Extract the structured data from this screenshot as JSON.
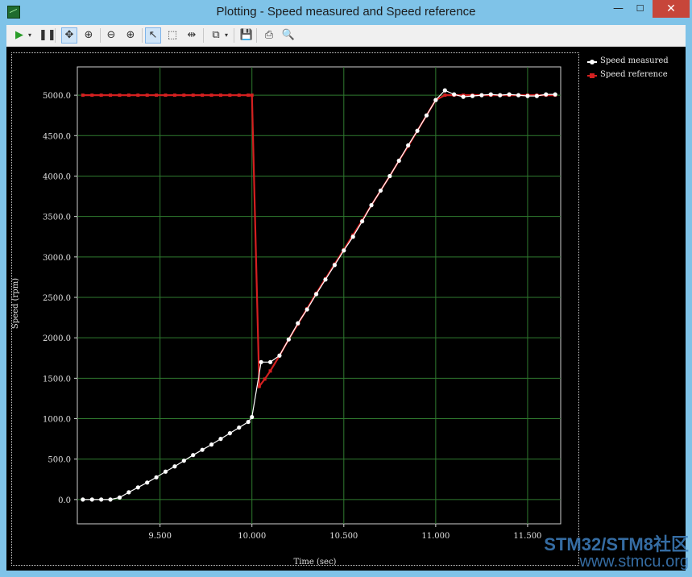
{
  "window": {
    "title": "Plotting  - Speed measured and Speed reference",
    "min_glyph": "—",
    "max_glyph": "☐",
    "close_glyph": "✕"
  },
  "toolbar": {
    "items": [
      {
        "name": "play-icon",
        "glyph": "▶",
        "color": "#2a9d2a"
      },
      {
        "name": "play-dropdown-icon",
        "glyph": "▾"
      },
      {
        "name": "pause-icon",
        "glyph": "❚❚"
      },
      {
        "name": "pan-icon",
        "glyph": "✥",
        "active": true
      },
      {
        "name": "zoom-area-icon",
        "glyph": "⊕"
      },
      {
        "name": "zoom-out-icon",
        "glyph": "⊖"
      },
      {
        "name": "zoom-in-icon",
        "glyph": "⊕"
      },
      {
        "name": "select-pointer-icon",
        "glyph": "↖",
        "active": true
      },
      {
        "name": "select-rect-icon",
        "glyph": "⬚"
      },
      {
        "name": "fit-width-icon",
        "glyph": "⇹"
      },
      {
        "name": "copy-icon",
        "glyph": "⧉"
      },
      {
        "name": "copy-dropdown-icon",
        "glyph": "▾"
      },
      {
        "name": "save-icon",
        "glyph": "💾"
      },
      {
        "name": "print-icon",
        "glyph": "⎙"
      },
      {
        "name": "print-preview-icon",
        "glyph": "🔍"
      }
    ]
  },
  "colors": {
    "measured": "#ffffff",
    "reference": "#d42020",
    "grid": "#2f7a2f",
    "axis": "#d0d0d0",
    "background": "#000000"
  },
  "watermark": {
    "line1": "STM32/STM8社区",
    "line2": "www.stmcu.org"
  },
  "chart_data": {
    "type": "line",
    "xlabel": "Time (sec)",
    "ylabel": "Speed (rpm)",
    "xlim": [
      9.05,
      11.68
    ],
    "ylim": [
      -300,
      5350
    ],
    "xticks": [
      9.5,
      10.0,
      10.5,
      11.0,
      11.5
    ],
    "xtick_labels": [
      "9.500",
      "10.000",
      "10.500",
      "11.000",
      "11.500"
    ],
    "yticks": [
      0,
      500,
      1000,
      1500,
      2000,
      2500,
      3000,
      3500,
      4000,
      4500,
      5000
    ],
    "ytick_labels": [
      "0.0",
      "500.0",
      "1000.0",
      "1500.0",
      "2000.0",
      "2500.0",
      "3000.0",
      "3500.0",
      "4000.0",
      "4500.0",
      "5000.0"
    ],
    "grid": true,
    "legend_position": "right",
    "series": [
      {
        "name": "Speed measured",
        "marker": "circle",
        "x": [
          9.08,
          9.13,
          9.18,
          9.23,
          9.28,
          9.33,
          9.38,
          9.43,
          9.48,
          9.53,
          9.58,
          9.63,
          9.68,
          9.73,
          9.78,
          9.83,
          9.88,
          9.93,
          9.98,
          10.0,
          10.05,
          10.1,
          10.15,
          10.2,
          10.25,
          10.3,
          10.35,
          10.4,
          10.45,
          10.5,
          10.55,
          10.6,
          10.65,
          10.7,
          10.75,
          10.8,
          10.85,
          10.9,
          10.95,
          11.0,
          11.05,
          11.1,
          11.15,
          11.2,
          11.25,
          11.3,
          11.35,
          11.4,
          11.45,
          11.5,
          11.55,
          11.6,
          11.65
        ],
        "y": [
          0,
          0,
          0,
          0,
          25,
          90,
          150,
          210,
          275,
          345,
          410,
          480,
          550,
          615,
          680,
          750,
          820,
          890,
          960,
          1020,
          1700,
          1700,
          1780,
          1980,
          2180,
          2350,
          2540,
          2720,
          2900,
          3080,
          3250,
          3440,
          3640,
          3820,
          4000,
          4190,
          4380,
          4560,
          4750,
          4940,
          5060,
          5010,
          4980,
          4990,
          5000,
          5010,
          5000,
          5010,
          5000,
          4990,
          4990,
          5010,
          5010
        ]
      },
      {
        "name": "Speed reference",
        "marker": "square",
        "x": [
          9.08,
          9.13,
          9.18,
          9.23,
          9.28,
          9.33,
          9.38,
          9.43,
          9.48,
          9.53,
          9.58,
          9.63,
          9.68,
          9.73,
          9.78,
          9.83,
          9.88,
          9.93,
          9.98,
          10.0,
          10.04,
          10.07,
          10.1,
          10.15,
          10.2,
          10.25,
          10.3,
          10.35,
          10.4,
          10.45,
          10.5,
          10.55,
          10.6,
          10.65,
          10.7,
          10.75,
          10.8,
          10.85,
          10.9,
          10.95,
          11.0,
          11.05,
          11.1,
          11.15,
          11.2,
          11.25,
          11.3,
          11.35,
          11.4,
          11.45,
          11.5,
          11.55,
          11.6,
          11.65
        ],
        "y": [
          5000,
          5000,
          5000,
          5000,
          5000,
          5000,
          5000,
          5000,
          5000,
          5000,
          5000,
          5000,
          5000,
          5000,
          5000,
          5000,
          5000,
          5000,
          5000,
          5000,
          1400,
          1490,
          1590,
          1780,
          1980,
          2170,
          2360,
          2550,
          2730,
          2910,
          3090,
          3270,
          3450,
          3640,
          3820,
          4000,
          4190,
          4370,
          4560,
          4750,
          4940,
          5000,
          5000,
          5000,
          5000,
          5000,
          5000,
          5000,
          5000,
          5000,
          5000,
          5000,
          5000,
          5000
        ]
      }
    ]
  }
}
